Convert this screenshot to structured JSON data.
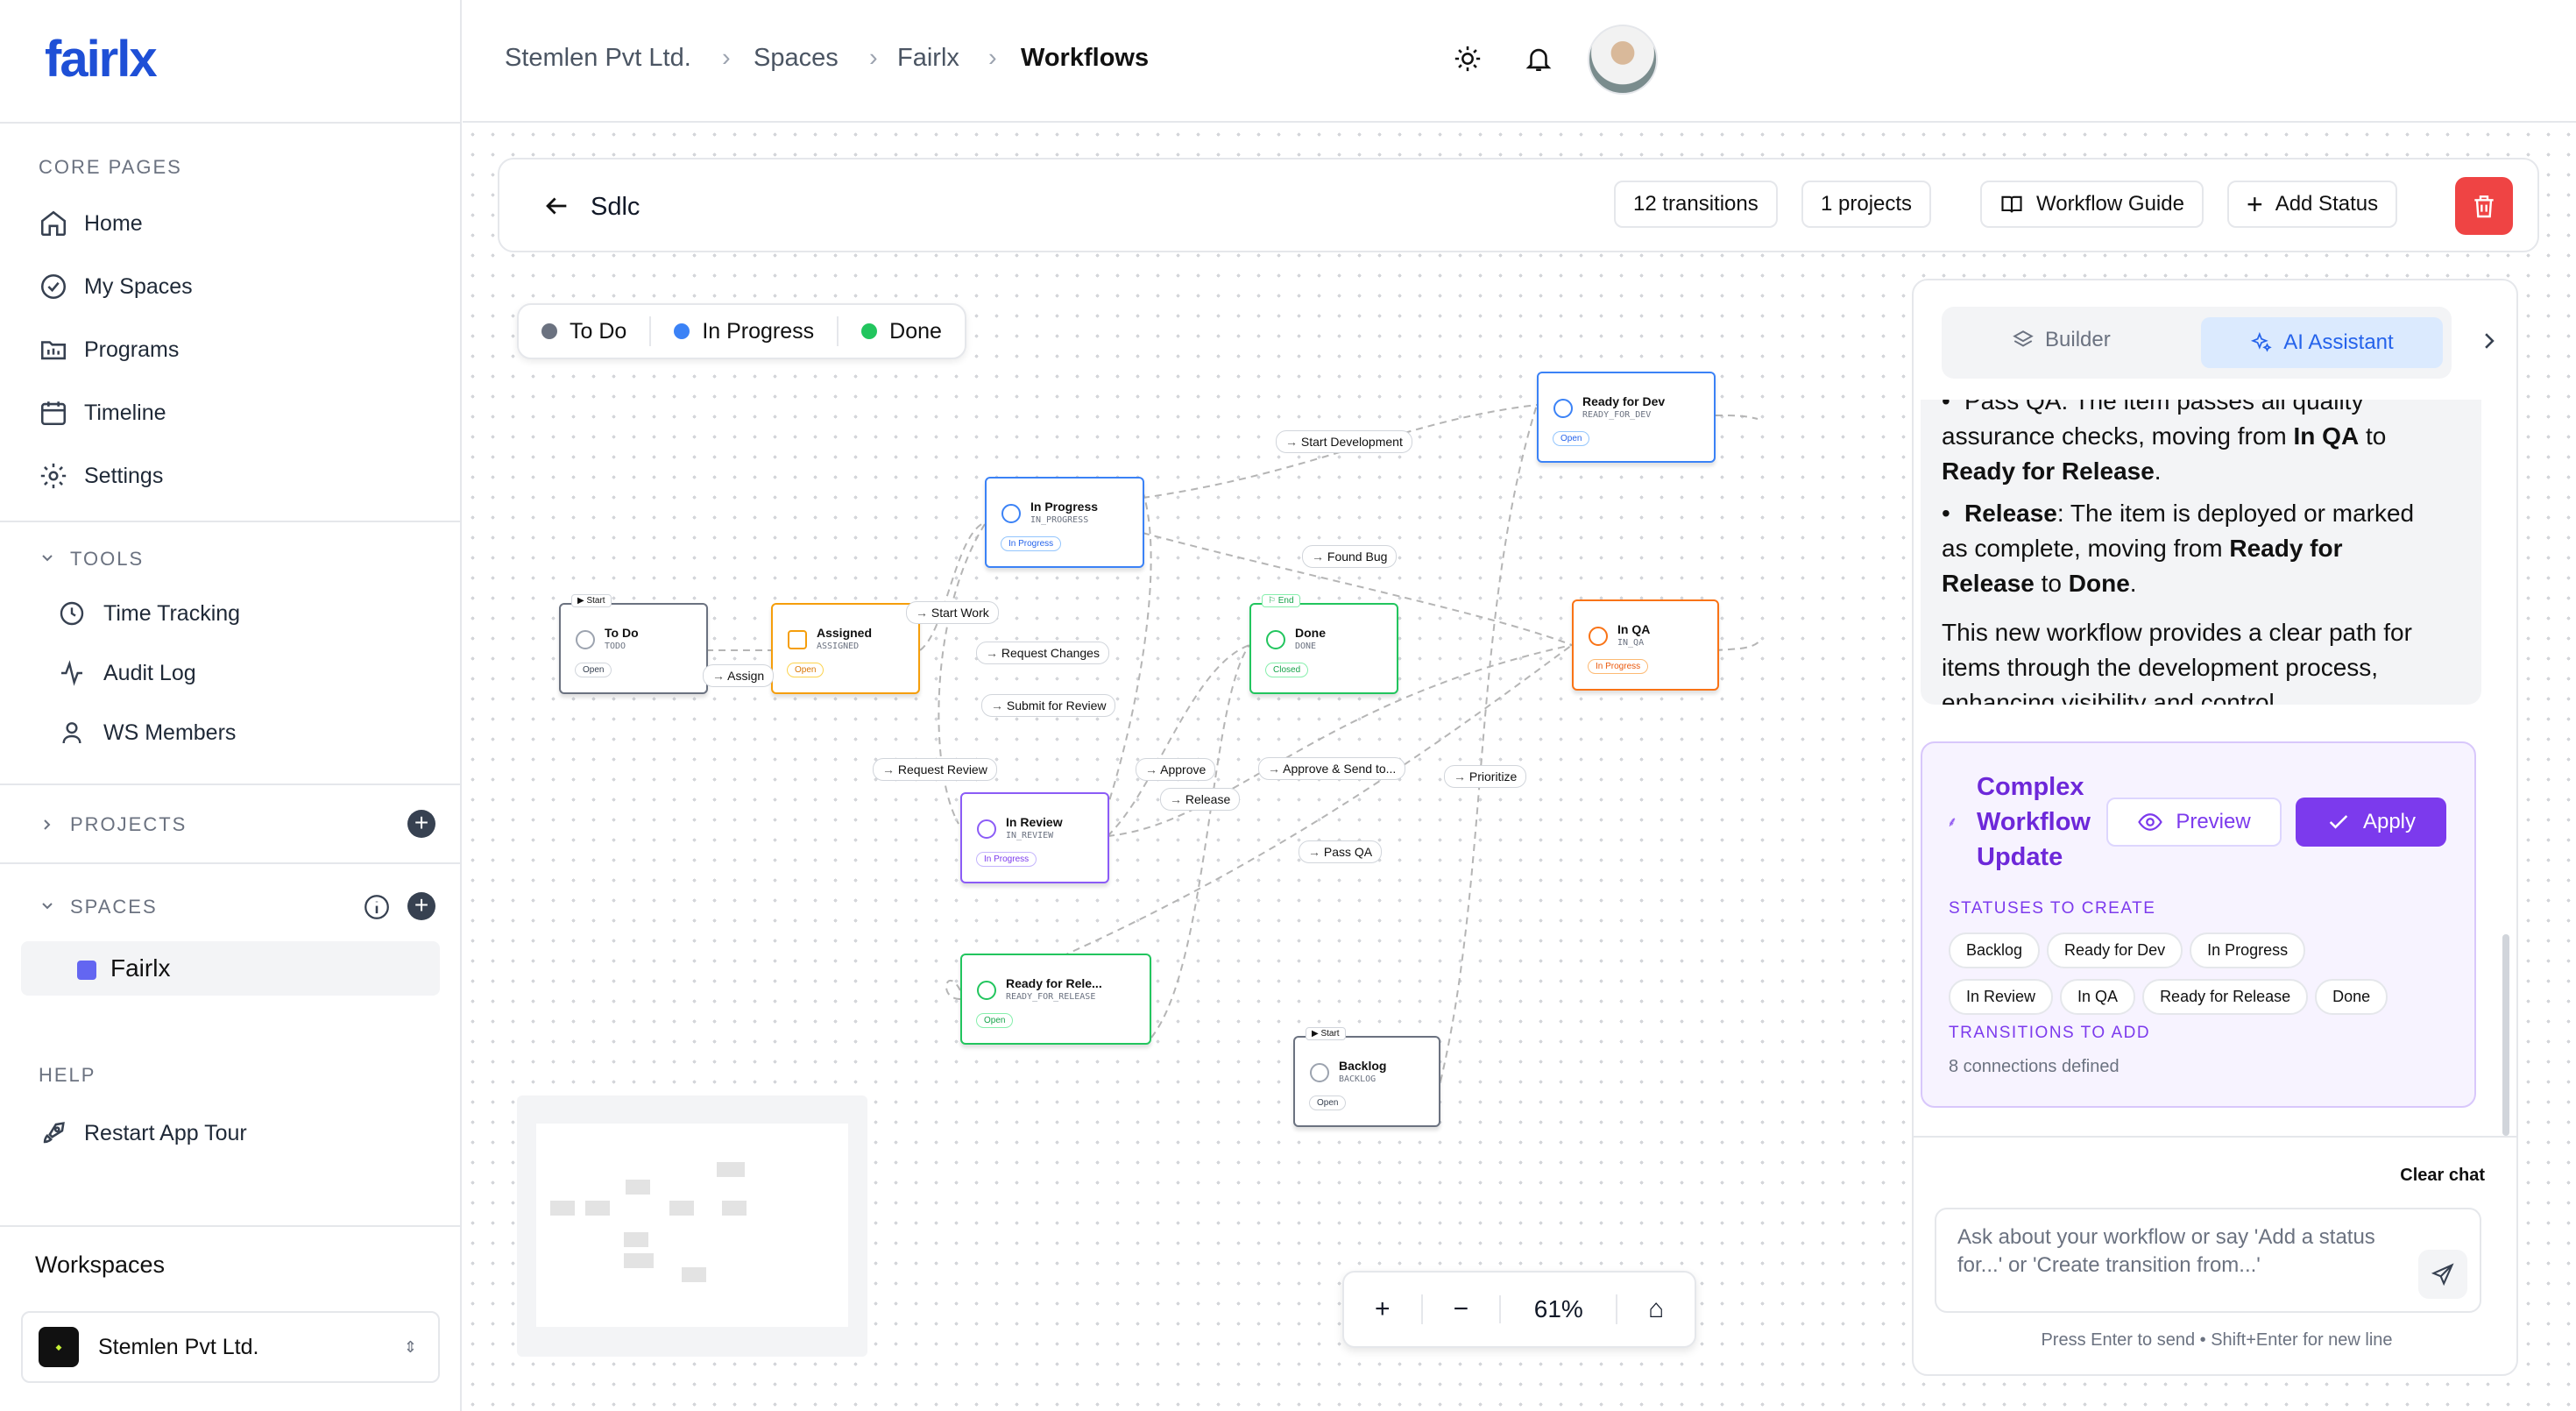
{
  "app": {
    "logo": "fairlx"
  },
  "sidebar": {
    "core_title": "CORE PAGES",
    "core": [
      {
        "label": "Home",
        "icon": "home-icon"
      },
      {
        "label": "My Spaces",
        "icon": "check-circle-icon"
      },
      {
        "label": "Programs",
        "icon": "folder-icon"
      },
      {
        "label": "Timeline",
        "icon": "calendar-icon"
      },
      {
        "label": "Settings",
        "icon": "gear-icon"
      }
    ],
    "tools_title": "TOOLS",
    "tools": [
      {
        "label": "Time Tracking",
        "icon": "clock-icon"
      },
      {
        "label": "Audit Log",
        "icon": "activity-icon"
      },
      {
        "label": "WS Members",
        "icon": "user-icon"
      }
    ],
    "projects_title": "PROJECTS",
    "spaces_title": "SPACES",
    "space_item": "Fairlx",
    "help_title": "HELP",
    "help_item": "Restart App Tour",
    "workspaces_title": "Workspaces",
    "workspace": "Stemlen Pvt Ltd."
  },
  "breadcrumb": [
    "Stemlen Pvt Ltd.",
    "Spaces",
    "Fairlx",
    "Workflows"
  ],
  "header": {
    "title": "Sdlc",
    "transitions": "12 transitions",
    "projects": "1 projects",
    "guide": "Workflow Guide",
    "add_status": "Add Status"
  },
  "legend": [
    {
      "label": "To Do",
      "color": "#6b7280"
    },
    {
      "label": "In Progress",
      "color": "#3b82f6"
    },
    {
      "label": "Done",
      "color": "#22c55e"
    }
  ],
  "nodes": {
    "todo": {
      "title": "To Do",
      "key": "TODO",
      "status": "Open",
      "tag": "Start"
    },
    "assigned": {
      "title": "Assigned",
      "key": "ASSIGNED",
      "status": "Open"
    },
    "inprogress": {
      "title": "In Progress",
      "key": "IN_PROGRESS",
      "status": "In Progress"
    },
    "readydev": {
      "title": "Ready for Dev",
      "key": "READY_FOR_DEV",
      "status": "Open"
    },
    "done": {
      "title": "Done",
      "key": "DONE",
      "status": "Closed",
      "tag": "End"
    },
    "inqa": {
      "title": "In QA",
      "key": "IN_QA",
      "status": "In Progress"
    },
    "inreview": {
      "title": "In Review",
      "key": "IN_REVIEW",
      "status": "In Progress"
    },
    "readyrel": {
      "title": "Ready for Rele...",
      "key": "READY_FOR_RELEASE",
      "status": "Open"
    },
    "backlog": {
      "title": "Backlog",
      "key": "BACKLOG",
      "status": "Open",
      "tag": "Start"
    }
  },
  "edges": [
    "Start Development",
    "Found Bug",
    "Start Work",
    "Assign",
    "Request Changes",
    "Submit for Review",
    "Request Review",
    "Approve",
    "Release",
    "Approve & Send to...",
    "Prioritize",
    "Pass QA"
  ],
  "zoom": {
    "plus": "+",
    "minus": "−",
    "level": "61%",
    "home": "⌂"
  },
  "panel": {
    "tab_builder": "Builder",
    "tab_ai": "AI Assistant",
    "msg_top": "Pass QA: The item passes all quality",
    "msg_1a": "assurance checks, moving from ",
    "msg_1b": "In QA",
    "msg_1c": " to",
    "msg_1d": "Ready for Release",
    "msg_2a": "Release",
    "msg_2b": ": The item is deployed or marked",
    "msg_2c": "as complete, moving from ",
    "msg_2d": "Ready for",
    "msg_2e": "Release",
    "msg_2f": " to ",
    "msg_2g": "Done",
    "msg_3": "This new workflow provides a clear path for items through the development process, enhancing visibility and control.",
    "card_title": "Complex Workflow Update",
    "preview": "Preview",
    "apply": "Apply",
    "statuses_title": "STATUSES TO CREATE",
    "statuses": [
      "Backlog",
      "Ready for Dev",
      "In Progress",
      "In Review",
      "In QA",
      "Ready for Release",
      "Done"
    ],
    "transitions_title": "TRANSITIONS TO ADD",
    "transitions_text": "8 connections defined",
    "clear": "Clear chat",
    "placeholder": "Ask about your workflow or say 'Add a status for...' or 'Create transition from...'",
    "hint": "Press Enter to send • Shift+Enter for new line"
  }
}
